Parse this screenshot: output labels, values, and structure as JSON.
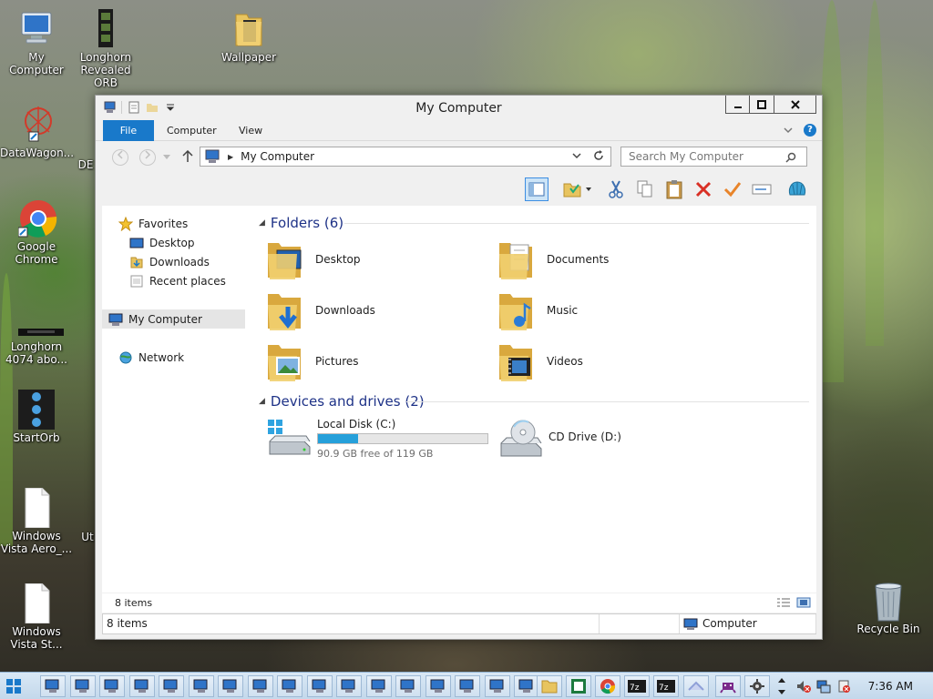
{
  "desktop": {
    "icons": [
      {
        "label": "My Computer"
      },
      {
        "label": "Longhorn Revealed ORB"
      },
      {
        "label": "Wallpaper"
      },
      {
        "label": "DataWagon..."
      },
      {
        "label": "Google Chrome"
      },
      {
        "label": "Longhorn 4074 abo..."
      },
      {
        "label": "StartOrb"
      },
      {
        "label": "Windows Vista Aero_..."
      },
      {
        "label": "Windows Vista St..."
      },
      {
        "label": "Recycle Bin"
      },
      {
        "label": "DE"
      },
      {
        "label": "Ut"
      }
    ]
  },
  "window": {
    "title": "My Computer",
    "ribbon_tabs": {
      "file": "File",
      "computer": "Computer",
      "view": "View"
    },
    "address": {
      "location": "My Computer"
    },
    "search": {
      "placeholder": "Search My Computer"
    },
    "sidebar": {
      "favorites": "Favorites",
      "desktop": "Desktop",
      "downloads": "Downloads",
      "recent": "Recent places",
      "my_computer": "My Computer",
      "network": "Network"
    },
    "folders_group": "Folders (6)",
    "folders": [
      {
        "name": "Desktop"
      },
      {
        "name": "Documents"
      },
      {
        "name": "Downloads"
      },
      {
        "name": "Music"
      },
      {
        "name": "Pictures"
      },
      {
        "name": "Videos"
      }
    ],
    "drives_group": "Devices and drives (2)",
    "drives": [
      {
        "name": "Local Disk (C:)",
        "free_text": "90.9 GB free of 119 GB",
        "used_fraction": 0.236
      },
      {
        "name": "CD Drive (D:)"
      }
    ],
    "content_status": {
      "count": "8 items"
    },
    "statusbar": {
      "count": "8 items",
      "location": "Computer"
    }
  },
  "taskbar": {
    "clock": "7:36 AM"
  },
  "colors": {
    "accent": "#1979ca",
    "group_heading": "#1e3287",
    "progress": "#26a0da",
    "folder": "#e8c45f"
  }
}
